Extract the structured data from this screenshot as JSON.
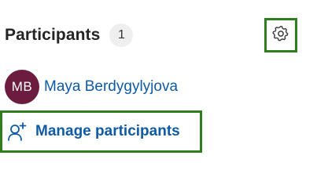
{
  "header": {
    "title": "Participants",
    "count": "1"
  },
  "settings": {
    "icon": "gear-icon"
  },
  "participants": [
    {
      "initials": "MB",
      "name": "Maya Berdygylyjova",
      "avatar_color": "#6b1c3f"
    }
  ],
  "manage": {
    "label": "Manage participants",
    "icon": "add-person-icon"
  },
  "colors": {
    "link": "#0f5aa6",
    "focus_outline": "#2e7d1e"
  }
}
